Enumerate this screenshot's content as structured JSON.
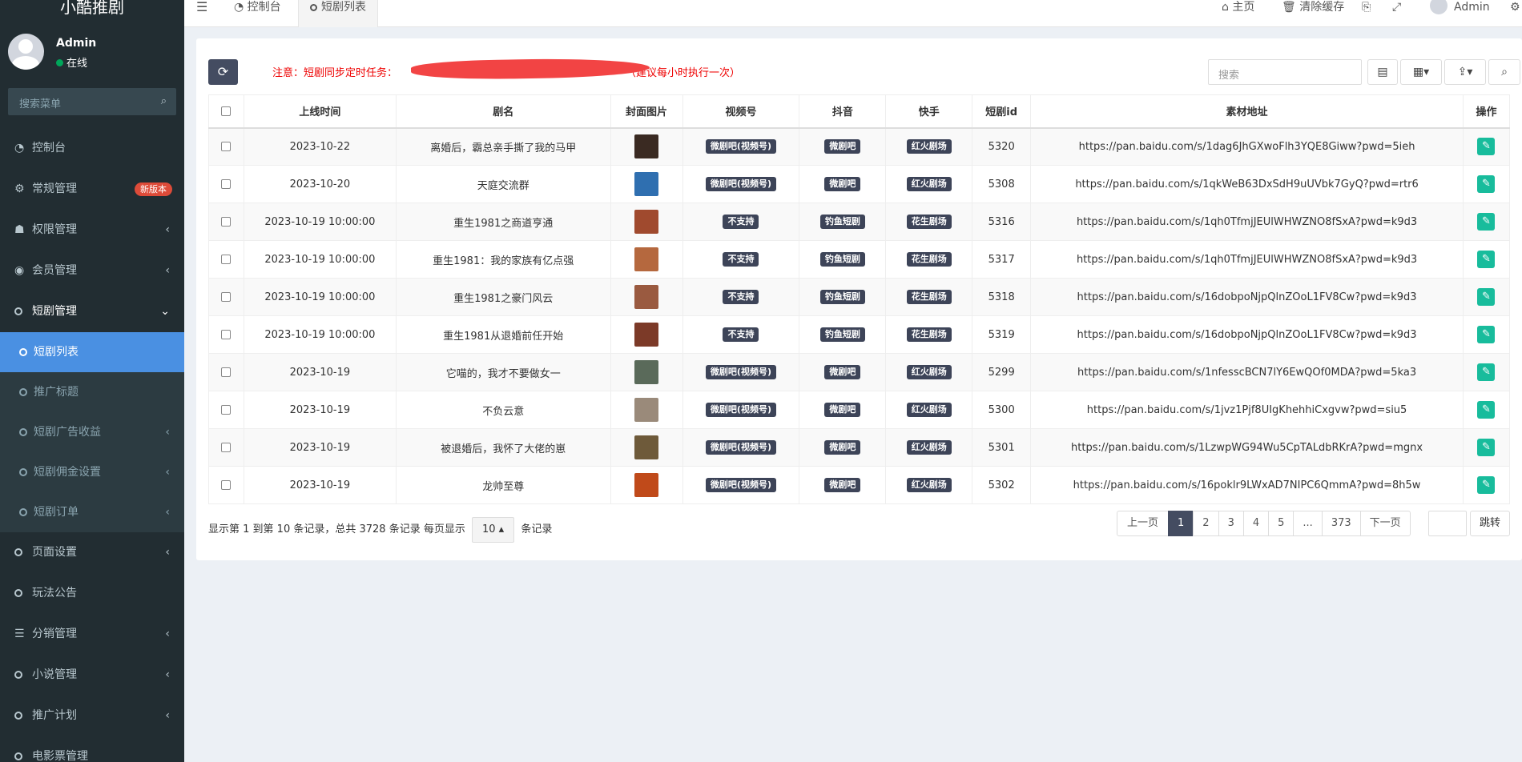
{
  "app": {
    "title": "小酷推剧"
  },
  "user": {
    "name": "Admin",
    "status": "在线"
  },
  "side_search": {
    "placeholder": "搜索菜单"
  },
  "menu": {
    "dashboard": "控制台",
    "general": "常规管理",
    "general_badge": "新版本",
    "permission": "权限管理",
    "member": "会员管理",
    "drama": "短剧管理",
    "drama_sub": [
      "短剧列表",
      "推广标题",
      "短剧广告收益",
      "短剧佣金设置",
      "短剧订单"
    ],
    "page_settings": "页面设置",
    "rules": "玩法公告",
    "distribution": "分销管理",
    "novel": "小说管理",
    "promo": "推广计划",
    "movie": "电影票管理"
  },
  "topbar": {
    "menu_icon": "hamburger-icon",
    "tab_dashboard": "控制台",
    "tab_active": "短剧列表",
    "home": "主页",
    "clear_cache": "清除缓存",
    "admin": "Admin"
  },
  "content": {
    "notice_prefix": "注意：短剧同步定时任务：",
    "notice_suffix": "（建议每小时执行一次）",
    "search_placeholder": "搜索"
  },
  "table": {
    "headers": [
      "上线时间",
      "剧名",
      "封面图片",
      "视频号",
      "抖音",
      "快手",
      "短剧id",
      "素材地址",
      "操作"
    ],
    "rows": [
      {
        "date": "2023-10-22",
        "name": "离婚后，霸总亲手撕了我的马甲",
        "video": "微剧吧(视频号)",
        "douyin": "微剧吧",
        "kuaishou": "红火剧场",
        "id": "5320",
        "url": "https://pan.baidu.com/s/1dag6JhGXwoFlh3YQE8Giww?pwd=5ieh",
        "thumb": "#3a2a22"
      },
      {
        "date": "2023-10-20",
        "name": "天庭交流群",
        "video": "微剧吧(视频号)",
        "douyin": "微剧吧",
        "kuaishou": "红火剧场",
        "id": "5308",
        "url": "https://pan.baidu.com/s/1qkWeB63DxSdH9uUVbk7GyQ?pwd=rtr6",
        "thumb": "#2f6fb0"
      },
      {
        "date": "2023-10-19 10:00:00",
        "name": "重生1981之商道亨通",
        "video": "不支持",
        "douyin": "钓鱼短剧",
        "kuaishou": "花生剧场",
        "id": "5316",
        "url": "https://pan.baidu.com/s/1qh0TfmjJEUlWHWZNO8fSxA?pwd=k9d3",
        "thumb": "#a04a2e"
      },
      {
        "date": "2023-10-19 10:00:00",
        "name": "重生1981：我的家族有亿点强",
        "video": "不支持",
        "douyin": "钓鱼短剧",
        "kuaishou": "花生剧场",
        "id": "5317",
        "url": "https://pan.baidu.com/s/1qh0TfmjJEUlWHWZNO8fSxA?pwd=k9d3",
        "thumb": "#b5683e"
      },
      {
        "date": "2023-10-19 10:00:00",
        "name": "重生1981之豪门风云",
        "video": "不支持",
        "douyin": "钓鱼短剧",
        "kuaishou": "花生剧场",
        "id": "5318",
        "url": "https://pan.baidu.com/s/16dobpoNjpQlnZOoL1FV8Cw?pwd=k9d3",
        "thumb": "#9a5a40"
      },
      {
        "date": "2023-10-19 10:00:00",
        "name": "重生1981从退婚前任开始",
        "video": "不支持",
        "douyin": "钓鱼短剧",
        "kuaishou": "花生剧场",
        "id": "5319",
        "url": "https://pan.baidu.com/s/16dobpoNjpQlnZOoL1FV8Cw?pwd=k9d3",
        "thumb": "#7c3a28"
      },
      {
        "date": "2023-10-19",
        "name": "它喵的，我才不要做女一",
        "video": "微剧吧(视频号)",
        "douyin": "微剧吧",
        "kuaishou": "红火剧场",
        "id": "5299",
        "url": "https://pan.baidu.com/s/1nfesscBCN7lY6EwQOf0MDA?pwd=5ka3",
        "thumb": "#5a6a5a"
      },
      {
        "date": "2023-10-19",
        "name": "不负云意",
        "video": "微剧吧(视频号)",
        "douyin": "微剧吧",
        "kuaishou": "红火剧场",
        "id": "5300",
        "url": "https://pan.baidu.com/s/1jvz1Pjf8UIgKhehhiCxgvw?pwd=siu5",
        "thumb": "#9a8a7a"
      },
      {
        "date": "2023-10-19",
        "name": "被退婚后，我怀了大佬的崽",
        "video": "微剧吧(视频号)",
        "douyin": "微剧吧",
        "kuaishou": "红火剧场",
        "id": "5301",
        "url": "https://pan.baidu.com/s/1LzwpWG94Wu5CpTALdbRKrA?pwd=mgnx",
        "thumb": "#6e5a3a"
      },
      {
        "date": "2023-10-19",
        "name": "龙帅至尊",
        "video": "微剧吧(视频号)",
        "douyin": "微剧吧",
        "kuaishou": "红火剧场",
        "id": "5302",
        "url": "https://pan.baidu.com/s/16poklr9LWxAD7NIPC6QmmA?pwd=8h5w",
        "thumb": "#c04a1a"
      }
    ]
  },
  "footer": {
    "info_prefix": "显示第 1 到第 10 条记录，总共 3728 条记录 每页显示",
    "page_size": "10",
    "info_suffix": "条记录",
    "prev": "上一页",
    "pages": [
      "1",
      "2",
      "3",
      "4",
      "5",
      "...",
      "373"
    ],
    "next": "下一页",
    "jump": "跳转"
  },
  "colors": {
    "accent": "#444c61",
    "sidebar": "#222d32",
    "active_sub": "#4a90e2",
    "edit": "#18bc9c",
    "badge": "#dd4b39"
  }
}
